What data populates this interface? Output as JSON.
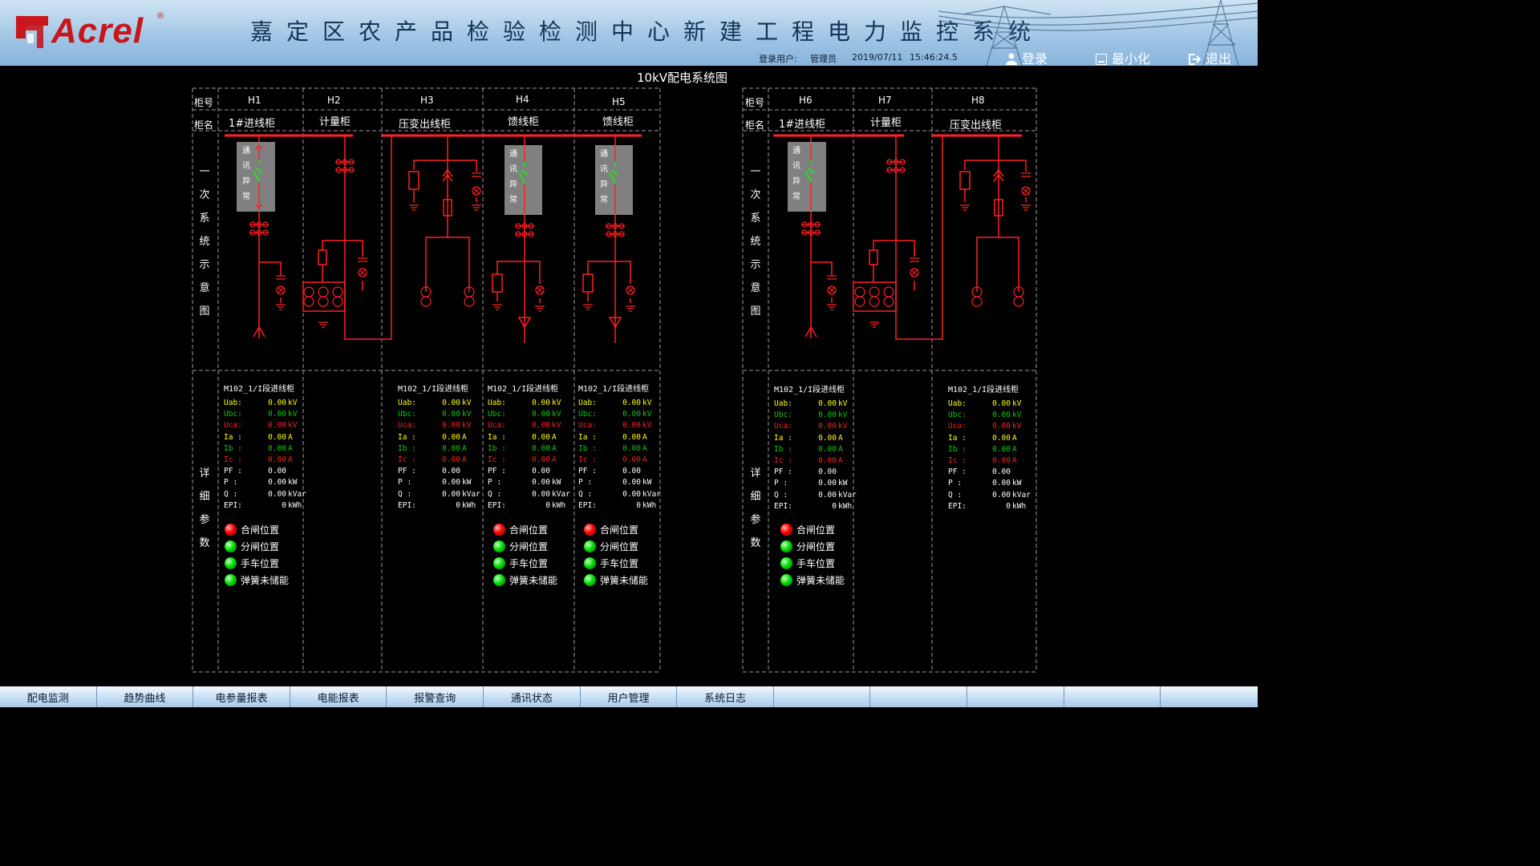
{
  "header": {
    "brand": "Acrel",
    "reg": "®",
    "title": "嘉定区农产品检验检测中心新建工程电力监控系统",
    "login_label": "登录用户:",
    "user": "管理员",
    "date": "2019/07/11",
    "time": "15:46:24.5",
    "buttons": {
      "login": "登录",
      "minimize": "最小化",
      "exit": "退出"
    }
  },
  "page_title": "10kV配电系统图",
  "labels": {
    "cab_no": "柜号",
    "cab_name": "柜名",
    "primary_chars": [
      "一",
      "次",
      "系",
      "统",
      "示",
      "意",
      "图"
    ],
    "detail_chars": [
      "详",
      "细",
      "参",
      "数"
    ],
    "comm_chars": [
      "通",
      "讯",
      "异",
      "常"
    ]
  },
  "groups": [
    {
      "cabinets": [
        {
          "id": "H1",
          "name": "1#进线柜"
        },
        {
          "id": "H2",
          "name": "计量柜"
        },
        {
          "id": "H3",
          "name": "压变出线柜"
        },
        {
          "id": "H4",
          "name": "馈线柜"
        },
        {
          "id": "H5",
          "name": "馈线柜"
        }
      ]
    },
    {
      "cabinets": [
        {
          "id": "H6",
          "name": "1#进线柜"
        },
        {
          "id": "H7",
          "name": "计量柜"
        },
        {
          "id": "H8",
          "name": "压变出线柜"
        }
      ]
    }
  ],
  "panel": {
    "title": "M102_1/I段进线柜",
    "rows": [
      {
        "name": "Uab:",
        "value": "0.00",
        "unit": "kV",
        "color": "#ffff00"
      },
      {
        "name": "Ubc:",
        "value": "0.00",
        "unit": "kV",
        "color": "#00d000"
      },
      {
        "name": "Uca:",
        "value": "0.00",
        "unit": "kV",
        "color": "#ff2020"
      },
      {
        "name": "Ia :",
        "value": "0.00",
        "unit": "A",
        "color": "#ffff00"
      },
      {
        "name": "Ib :",
        "value": "0.00",
        "unit": "A",
        "color": "#00d000"
      },
      {
        "name": "Ic :",
        "value": "0.00",
        "unit": "A",
        "color": "#ff2020"
      },
      {
        "name": "PF :",
        "value": "0.00",
        "unit": "",
        "color": "#ffffff"
      },
      {
        "name": "P  :",
        "value": "0.00",
        "unit": "kW",
        "color": "#ffffff"
      },
      {
        "name": "Q  :",
        "value": "0.00",
        "unit": "kVar",
        "color": "#ffffff"
      },
      {
        "name": "EPI:",
        "value": "0",
        "unit": "kWh",
        "color": "#ffffff"
      }
    ],
    "states": [
      {
        "label": "合闸位置",
        "color": "red"
      },
      {
        "label": "分闸位置",
        "color": "green"
      },
      {
        "label": "手车位置",
        "color": "green"
      },
      {
        "label": "弹簧未储能",
        "color": "green"
      }
    ]
  },
  "nav": [
    "配电监测",
    "趋势曲线",
    "电参量报表",
    "电能报表",
    "报警查询",
    "通讯状态",
    "用户管理",
    "系统日志",
    "",
    "",
    "",
    "",
    ""
  ]
}
